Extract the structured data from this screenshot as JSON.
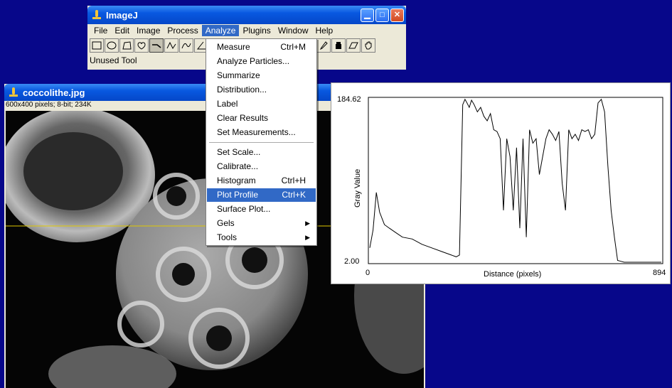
{
  "imagej": {
    "title": "ImageJ",
    "menus": [
      "File",
      "Edit",
      "Image",
      "Process",
      "Analyze",
      "Plugins",
      "Window",
      "Help"
    ],
    "status": "Unused Tool"
  },
  "image_window": {
    "title": "coccolithe.jpg",
    "info": "600x400 pixels; 8-bit; 234K"
  },
  "analyze_menu": {
    "items": [
      {
        "label": "Measure",
        "shortcut": "Ctrl+M"
      },
      {
        "label": "Analyze Particles...",
        "shortcut": ""
      },
      {
        "label": "Summarize",
        "shortcut": ""
      },
      {
        "label": "Distribution...",
        "shortcut": ""
      },
      {
        "label": "Label",
        "shortcut": ""
      },
      {
        "label": "Clear Results",
        "shortcut": ""
      },
      {
        "label": "Set Measurements...",
        "shortcut": ""
      },
      {
        "label": "Set Scale...",
        "shortcut": ""
      },
      {
        "label": "Calibrate...",
        "shortcut": ""
      },
      {
        "label": "Histogram",
        "shortcut": "Ctrl+H"
      },
      {
        "label": "Plot Profile",
        "shortcut": "Ctrl+K",
        "highlighted": true
      },
      {
        "label": "Surface Plot...",
        "shortcut": ""
      },
      {
        "label": "Gels",
        "shortcut": "",
        "submenu": true
      },
      {
        "label": "Tools",
        "shortcut": "",
        "submenu": true
      }
    ]
  },
  "profile_plot": {
    "ymax_label": "184.62",
    "ymin_label": "2.00",
    "x0_label": "0",
    "x1_label": "894",
    "ylabel": "Gray Value",
    "xlabel": "Distance (pixels)"
  },
  "chart_data": {
    "type": "line",
    "xlabel": "Distance (pixels)",
    "ylabel": "Gray Value",
    "xlim": [
      0,
      894
    ],
    "ylim": [
      2.0,
      184.62
    ],
    "grid": false,
    "series": [
      {
        "x": [
          0,
          10,
          20,
          30,
          45,
          60,
          80,
          100,
          130,
          160,
          190,
          220,
          250,
          265,
          275,
          285,
          292,
          298,
          305,
          312,
          320,
          330,
          340,
          350,
          360,
          370,
          380,
          390,
          400,
          410,
          420,
          430,
          440,
          450,
          460,
          470,
          480,
          490,
          500,
          510,
          520,
          530,
          540,
          550,
          560,
          570,
          580,
          590,
          600,
          610,
          620,
          630,
          640,
          650,
          660,
          670,
          680,
          690,
          700,
          710,
          720,
          730,
          740,
          750,
          760,
          770,
          780,
          790,
          800,
          810,
          820,
          830,
          894
        ],
        "values": [
          18,
          38,
          80,
          58,
          44,
          40,
          35,
          30,
          28,
          22,
          18,
          14,
          10,
          8,
          10,
          178,
          184,
          180,
          175,
          183,
          178,
          170,
          175,
          165,
          160,
          168,
          150,
          148,
          140,
          60,
          140,
          120,
          60,
          130,
          40,
          140,
          30,
          150,
          135,
          140,
          100,
          120,
          140,
          150,
          145,
          138,
          148,
          90,
          60,
          150,
          140,
          145,
          138,
          150,
          148,
          150,
          140,
          145,
          180,
          184,
          170,
          110,
          60,
          30,
          4,
          3,
          2,
          2,
          2,
          2,
          2,
          2,
          2
        ]
      }
    ]
  },
  "colors": {
    "desktop": "#07078a",
    "title_bar": "#0858e0",
    "menu_highlight": "#3169c6",
    "selection_line": "#e0c800"
  },
  "icons": {
    "tools": [
      "rectangle-tool-icon",
      "oval-tool-icon",
      "polygon-tool-icon",
      "freehand-tool-icon",
      "straight-line-tool-icon",
      "segmented-line-tool-icon",
      "freehand-line-tool-icon",
      "angle-tool-icon",
      "dropper-tool-icon",
      "color-picker-icon",
      "eraser-icon",
      "hand-tool-icon"
    ]
  }
}
